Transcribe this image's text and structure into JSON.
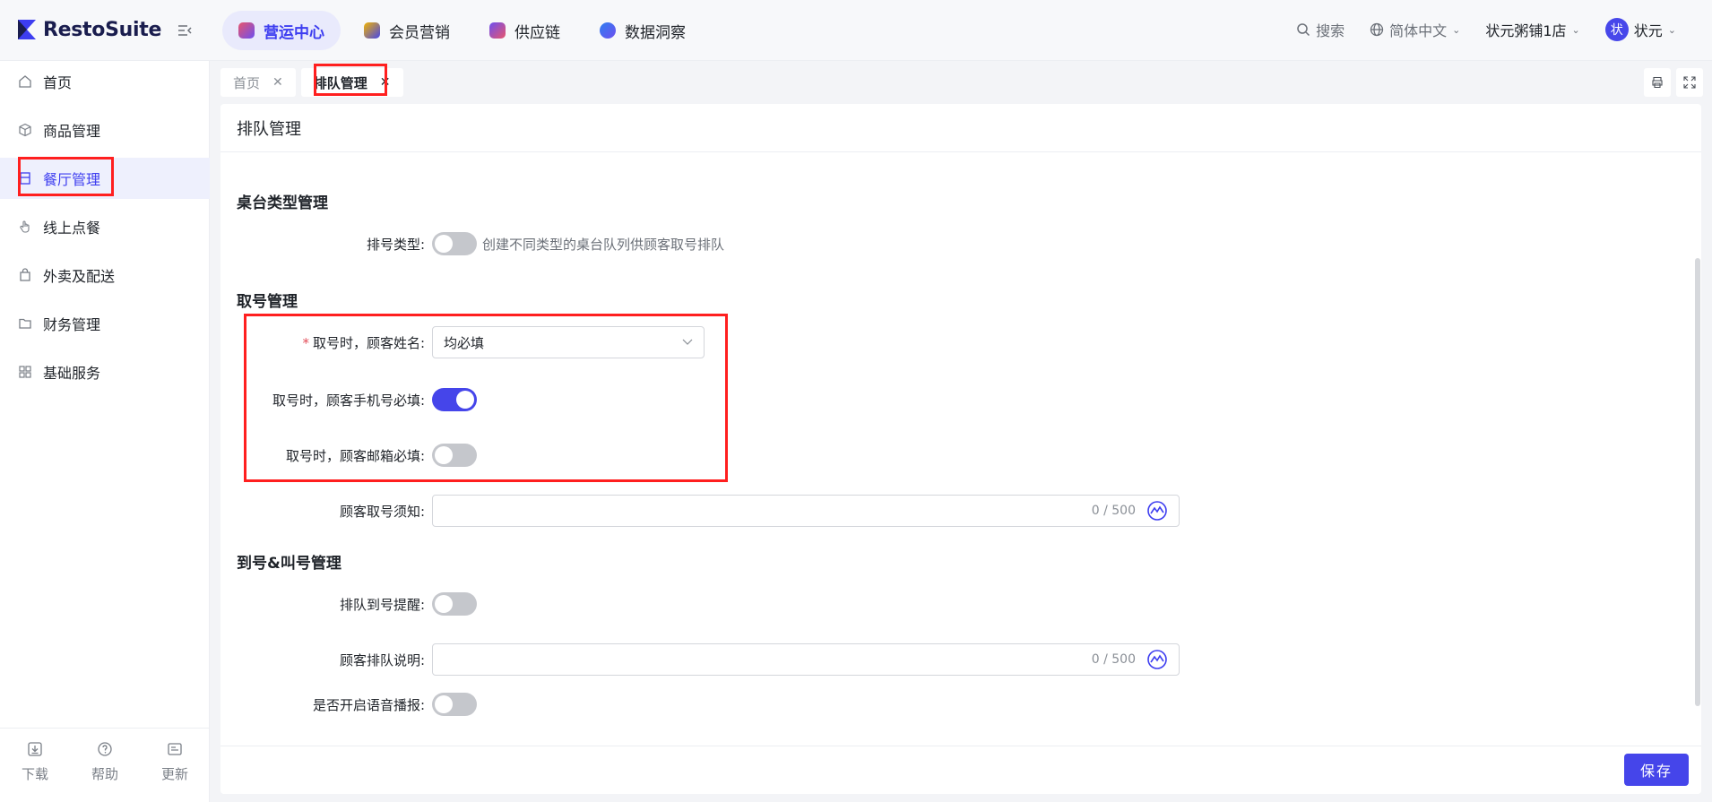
{
  "app": {
    "name": "RestoSuite"
  },
  "nav": [
    {
      "label": "营运中心",
      "active": true,
      "color": "#e8556d"
    },
    {
      "label": "会员营销",
      "active": false,
      "color": "#f2b400"
    },
    {
      "label": "供应链",
      "active": false,
      "color": "#6d4ff0"
    },
    {
      "label": "数据洞察",
      "active": false,
      "color": "#2f7ff0"
    }
  ],
  "topright": {
    "search": "搜索",
    "language": "简体中文",
    "store": "状元粥铺1店",
    "avatar_char": "状",
    "user": "状元"
  },
  "sidebar": {
    "items": [
      {
        "label": "首页",
        "icon": "home-icon"
      },
      {
        "label": "商品管理",
        "icon": "box-icon"
      },
      {
        "label": "餐厅管理",
        "icon": "restaurant-icon",
        "active": true
      },
      {
        "label": "线上点餐",
        "icon": "hand-icon"
      },
      {
        "label": "外卖及配送",
        "icon": "bag-icon"
      },
      {
        "label": "财务管理",
        "icon": "folder-icon"
      },
      {
        "label": "基础服务",
        "icon": "grid-icon"
      }
    ],
    "bottom": [
      {
        "label": "下载",
        "icon": "download-icon"
      },
      {
        "label": "帮助",
        "icon": "help-icon"
      },
      {
        "label": "更新",
        "icon": "update-icon"
      }
    ]
  },
  "tabs": [
    {
      "label": "首页",
      "active": false
    },
    {
      "label": "排队管理",
      "active": true
    }
  ],
  "page": {
    "title": "排队管理",
    "sections": {
      "table_type": "桌台类型管理",
      "ticket": "取号管理",
      "arrival": "到号&叫号管理"
    },
    "fields": {
      "queue_type": {
        "label": "排号类型:",
        "on": false,
        "hint": "创建不同类型的桌台队列供顾客取号排队"
      },
      "name_required": {
        "label": "取号时，顾客姓名:",
        "value": "均必填"
      },
      "phone_required": {
        "label": "取号时，顾客手机号必填:",
        "on": true
      },
      "email_required": {
        "label": "取号时，顾客邮箱必填:",
        "on": false
      },
      "ticket_notice": {
        "label": "顾客取号须知:",
        "counter": "0 / 500"
      },
      "arrival_reminder": {
        "label": "排队到号提醒:",
        "on": false
      },
      "queue_description": {
        "label": "顾客排队说明:",
        "counter": "0 / 500"
      },
      "voice_broadcast": {
        "label": "是否开启语音播报:",
        "on": false
      }
    },
    "save_label": "保存"
  },
  "colors": {
    "accent": "#4545ea",
    "highlight": "#ff1f1f"
  }
}
